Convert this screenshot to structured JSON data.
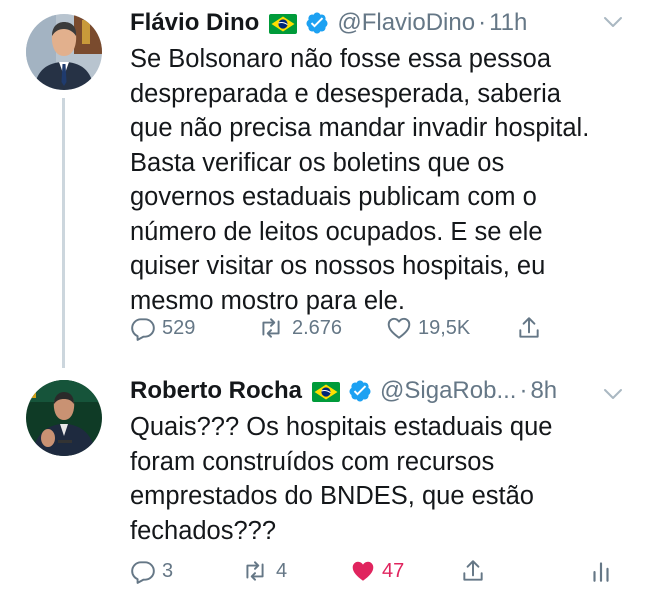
{
  "colors": {
    "text": "#14171a",
    "secondary": "#657786",
    "verified": "#1da1f2",
    "like": "#e0245e",
    "thread_line": "#ccd6dd"
  },
  "tweets": [
    {
      "name": "Flávio Dino",
      "handle": "@FlavioDino",
      "separator": "·",
      "time": "11h",
      "text_lines": [
        "Se Bolsonaro não fosse essa pessoa",
        "despreparada e desesperada, saberia",
        "que não precisa mandar invadir hospital.",
        "Basta verificar os boletins que os",
        "governos estaduais publicam com o",
        "número de leitos ocupados. E se ele",
        "quiser visitar os nossos hospitais, eu",
        "mesmo mostro para ele."
      ],
      "replies": "529",
      "retweets": "2.676",
      "likes": "19,5K",
      "liked": false,
      "icons": [
        "brazil-flag-icon",
        "verified-badge-icon",
        "chevron-down-icon",
        "reply-icon",
        "retweet-icon",
        "heart-icon",
        "share-icon"
      ]
    },
    {
      "name": "Roberto Rocha",
      "handle": "@SigaRob...",
      "separator": "·",
      "time": "8h",
      "text_lines": [
        "Quais??? Os hospitais estaduais que",
        "foram construídos com recursos",
        "emprestados do BNDES, que estão",
        "fechados???"
      ],
      "replies": "3",
      "retweets": "4",
      "likes": "47",
      "liked": true,
      "icons": [
        "brazil-flag-icon",
        "verified-badge-icon",
        "chevron-down-icon",
        "reply-icon",
        "retweet-icon",
        "heart-filled-icon",
        "share-icon",
        "analytics-icon"
      ]
    }
  ]
}
